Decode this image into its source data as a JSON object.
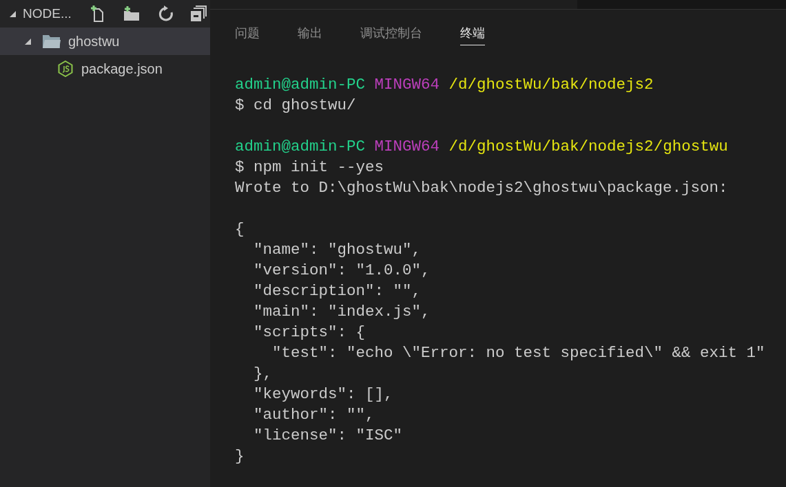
{
  "explorer": {
    "title": "NODE...",
    "expanded": true,
    "tree": [
      {
        "label": "ghostwu",
        "kind": "folder",
        "expanded": true,
        "selected": true,
        "children": [
          {
            "label": "package.json",
            "kind": "js",
            "selected": false
          }
        ]
      }
    ]
  },
  "panel": {
    "tabs": [
      {
        "label": "问题",
        "selected": false
      },
      {
        "label": "输出",
        "selected": false
      },
      {
        "label": "调试控制台",
        "selected": false
      },
      {
        "label": "终端",
        "selected": true
      }
    ],
    "terminal": [
      [
        {
          "kind": "prompt",
          "user": "admin@admin-PC",
          "shell": "MINGW64",
          "path": "/d/ghostWu/bak/nodejs2"
        },
        {
          "kind": "text",
          "text": "$ cd ghostwu/"
        }
      ],
      [
        {
          "kind": "prompt",
          "user": "admin@admin-PC",
          "shell": "MINGW64",
          "path": "/d/ghostWu/bak/nodejs2/ghostwu"
        },
        {
          "kind": "text",
          "text": "$ npm init --yes"
        },
        {
          "kind": "text",
          "text": "Wrote to D:\\ghostWu\\bak\\nodejs2\\ghostwu\\package.json:"
        }
      ],
      [
        {
          "kind": "text",
          "text": "{"
        },
        {
          "kind": "text",
          "text": "  \"name\": \"ghostwu\","
        },
        {
          "kind": "text",
          "text": "  \"version\": \"1.0.0\","
        },
        {
          "kind": "text",
          "text": "  \"description\": \"\","
        },
        {
          "kind": "text",
          "text": "  \"main\": \"index.js\","
        },
        {
          "kind": "text",
          "text": "  \"scripts\": {"
        },
        {
          "kind": "text",
          "text": "    \"test\": \"echo \\\"Error: no test specified\\\" && exit 1\""
        },
        {
          "kind": "text",
          "text": "  },"
        },
        {
          "kind": "text",
          "text": "  \"keywords\": [],"
        },
        {
          "kind": "text",
          "text": "  \"author\": \"\","
        },
        {
          "kind": "text",
          "text": "  \"license\": \"ISC\""
        },
        {
          "kind": "text",
          "text": "}"
        }
      ]
    ]
  }
}
